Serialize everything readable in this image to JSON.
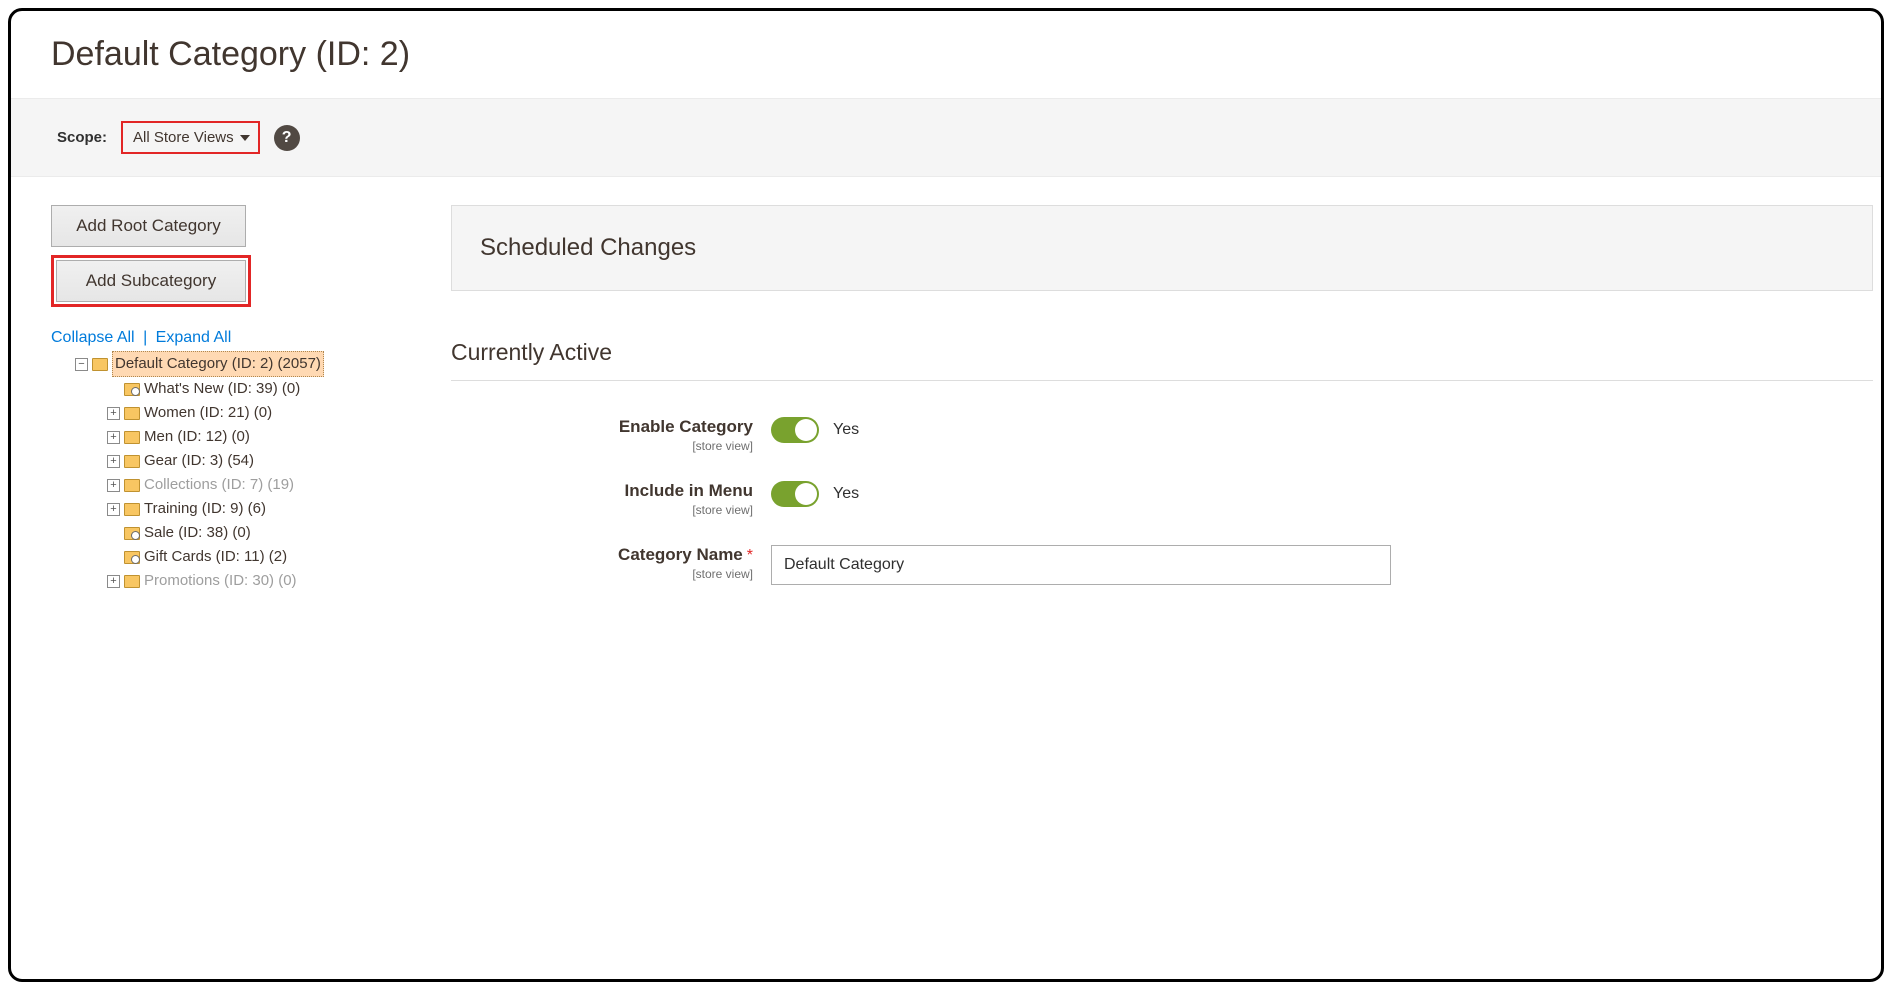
{
  "page_title": "Default Category (ID: 2)",
  "scope": {
    "label": "Scope:",
    "value": "All Store Views"
  },
  "buttons": {
    "add_root": "Add Root Category",
    "add_sub": "Add Subcategory"
  },
  "tree_controls": {
    "collapse": "Collapse All",
    "expand": "Expand All"
  },
  "tree": {
    "root": {
      "label": "Default Category (ID: 2) (2057)",
      "selected": true,
      "toggle": "−",
      "lens": false
    },
    "children": [
      {
        "label": "What's New (ID: 39) (0)",
        "toggle": "",
        "lens": true
      },
      {
        "label": "Women (ID: 21) (0)",
        "toggle": "+",
        "lens": false
      },
      {
        "label": "Men (ID: 12) (0)",
        "toggle": "+",
        "lens": false
      },
      {
        "label": "Gear (ID: 3) (54)",
        "toggle": "+",
        "lens": false
      },
      {
        "label": "Collections (ID: 7) (19)",
        "toggle": "+",
        "lens": false,
        "muted": true
      },
      {
        "label": "Training (ID: 9) (6)",
        "toggle": "+",
        "lens": false
      },
      {
        "label": "Sale (ID: 38) (0)",
        "toggle": "",
        "lens": true
      },
      {
        "label": "Gift Cards (ID: 11) (2)",
        "toggle": "",
        "lens": true
      },
      {
        "label": "Promotions (ID: 30) (0)",
        "toggle": "+",
        "lens": false,
        "muted": true
      }
    ]
  },
  "panel": {
    "scheduled_changes": "Scheduled Changes",
    "currently_active": "Currently Active"
  },
  "form": {
    "enable_category": {
      "label": "Enable Category",
      "scope": "[store view]",
      "value": "Yes",
      "on": true
    },
    "include_in_menu": {
      "label": "Include in Menu",
      "scope": "[store view]",
      "value": "Yes",
      "on": true
    },
    "category_name": {
      "label": "Category Name",
      "scope": "[store view]",
      "required": true,
      "value": "Default Category"
    }
  }
}
